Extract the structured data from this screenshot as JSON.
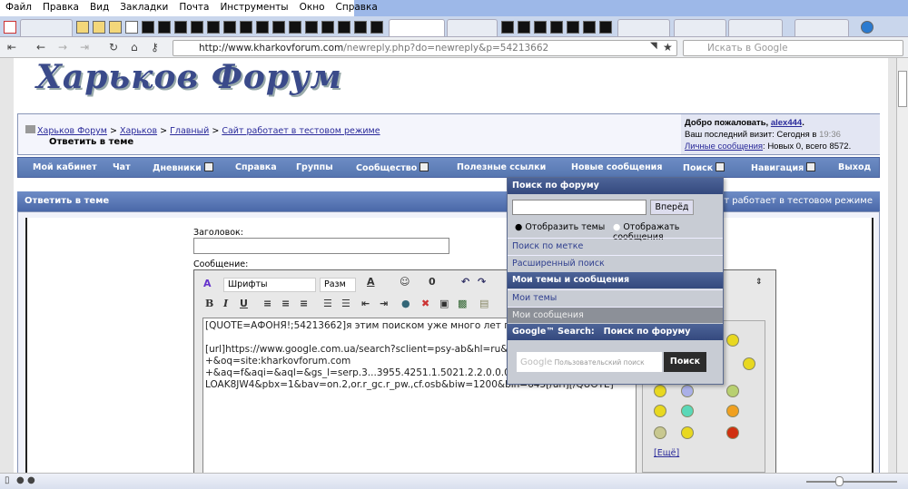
{
  "menu": [
    "Файл",
    "Правка",
    "Вид",
    "Закладки",
    "Почта",
    "Инструменты",
    "Окно",
    "Справка"
  ],
  "nav": {
    "url_host": "http://www.kharkovforum.com",
    "url_path": "/newreply.php?do=newreply&p=54213662",
    "search_placeholder": "Искать в Google"
  },
  "logo": "Харьков Форум",
  "breadcrumb": [
    "Харьков Форум",
    "Харьков",
    "Главный",
    "Сайт работает в тестовом режиме"
  ],
  "breadcrumb_sep": ">",
  "current": "Ответить в теме",
  "welcome": {
    "greeting": "Добро пожаловать,",
    "user": "alex444",
    "visit_label": "Ваш последний визит: Сегодня в",
    "visit_time": "19:36",
    "pm_link": "Личные сообщения",
    "pm_info": ": Новых 0, всего 8572."
  },
  "mainnav": [
    "Мой кабинет",
    "Чат",
    "Дневники",
    "Справка",
    "Группы",
    "Сообщество",
    "Полезные ссылки",
    "Новые сообщения",
    "Поиск",
    "Навигация",
    "Выход"
  ],
  "reply": {
    "title": "Ответить в теме",
    "thread": "а: Сайт работает в тестовом режиме"
  },
  "form": {
    "title_label": "Заголовок:",
    "message_label": "Сообщение:",
    "font_select": "Шрифты",
    "size_select": "Разм",
    "more_smilies": "[Ещё]",
    "message": "[QUOTE=АФОНЯ!;54213662]я этим поиском уже много лет польз\n\n[url]https://www.google.com.ua/search?sclient=psy-ab&hl=ru&q=si\n+&oq=site:kharkovforum.com\n+&aq=f&aqi=&aql=&gs_l=serp.3...3955.4251.1.5021.2.2.0.0.0.0.24\nLOAK8JW4&pbx=1&bav=on.2,or.r_gc.r_pw.,cf.osb&biw=1200&bih=645[/url][/QUOTE]"
  },
  "dropdown": {
    "header": "Поиск по форуму",
    "go": "Вперёд",
    "radio1": "Отобразить темы",
    "radio2": "Отображать сообщения",
    "tag_search": "Поиск по метке",
    "advanced": "Расширенный поиск",
    "my_header": "Мои темы и сообщения",
    "my_threads": "Мои темы",
    "my_posts": "Мои сообщения",
    "google_header": "Google™ Search:   Поиск по форуму",
    "google_placeholder": "Пользовательский поиск",
    "google_btn": "Поиск"
  }
}
